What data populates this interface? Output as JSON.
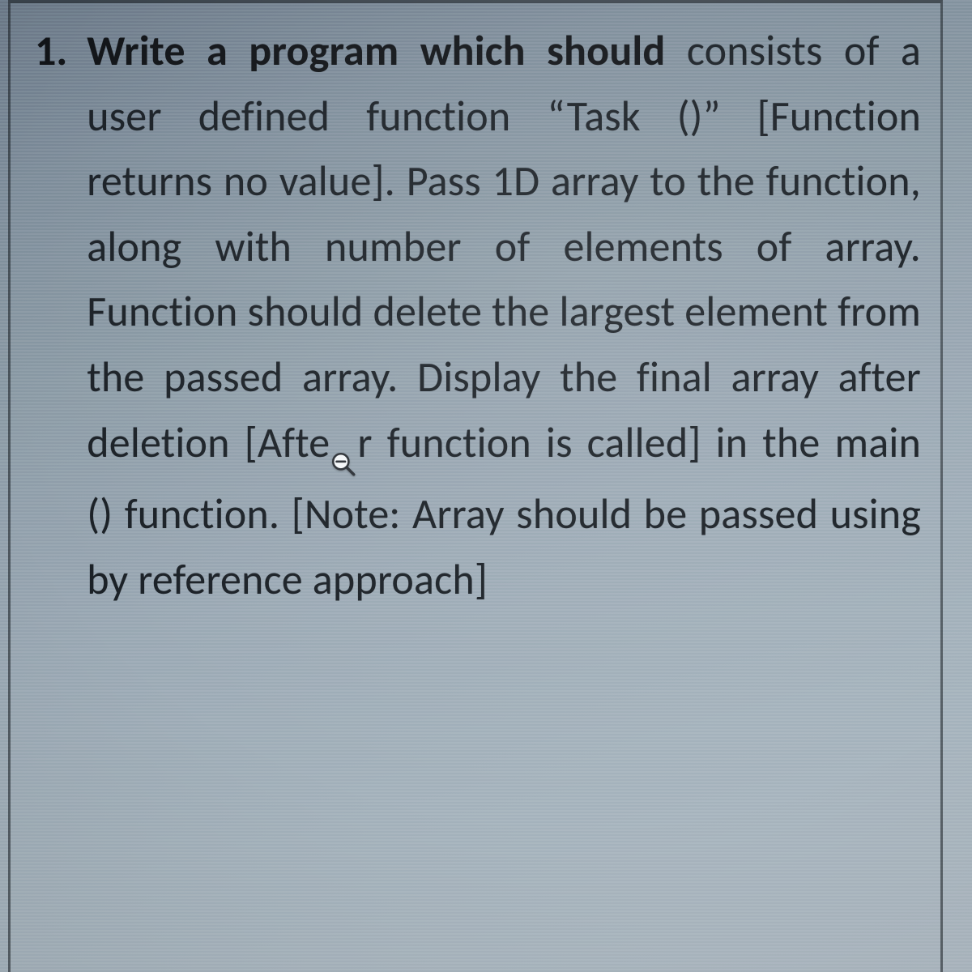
{
  "question": {
    "number": "1.",
    "lead": "Write a program which should",
    "text_part1": "consists of a user defined function “Task ()” [Function returns no value]. Pass 1D array to the function, along with number of elements of array. Function should delete the largest element from the passed array. Display the final array after deletion [Aft",
    "text_after_cursor": "r function is called] in the main () function. [Note: Array should be passed using by reference approach]",
    "cursor_letter": "e"
  }
}
